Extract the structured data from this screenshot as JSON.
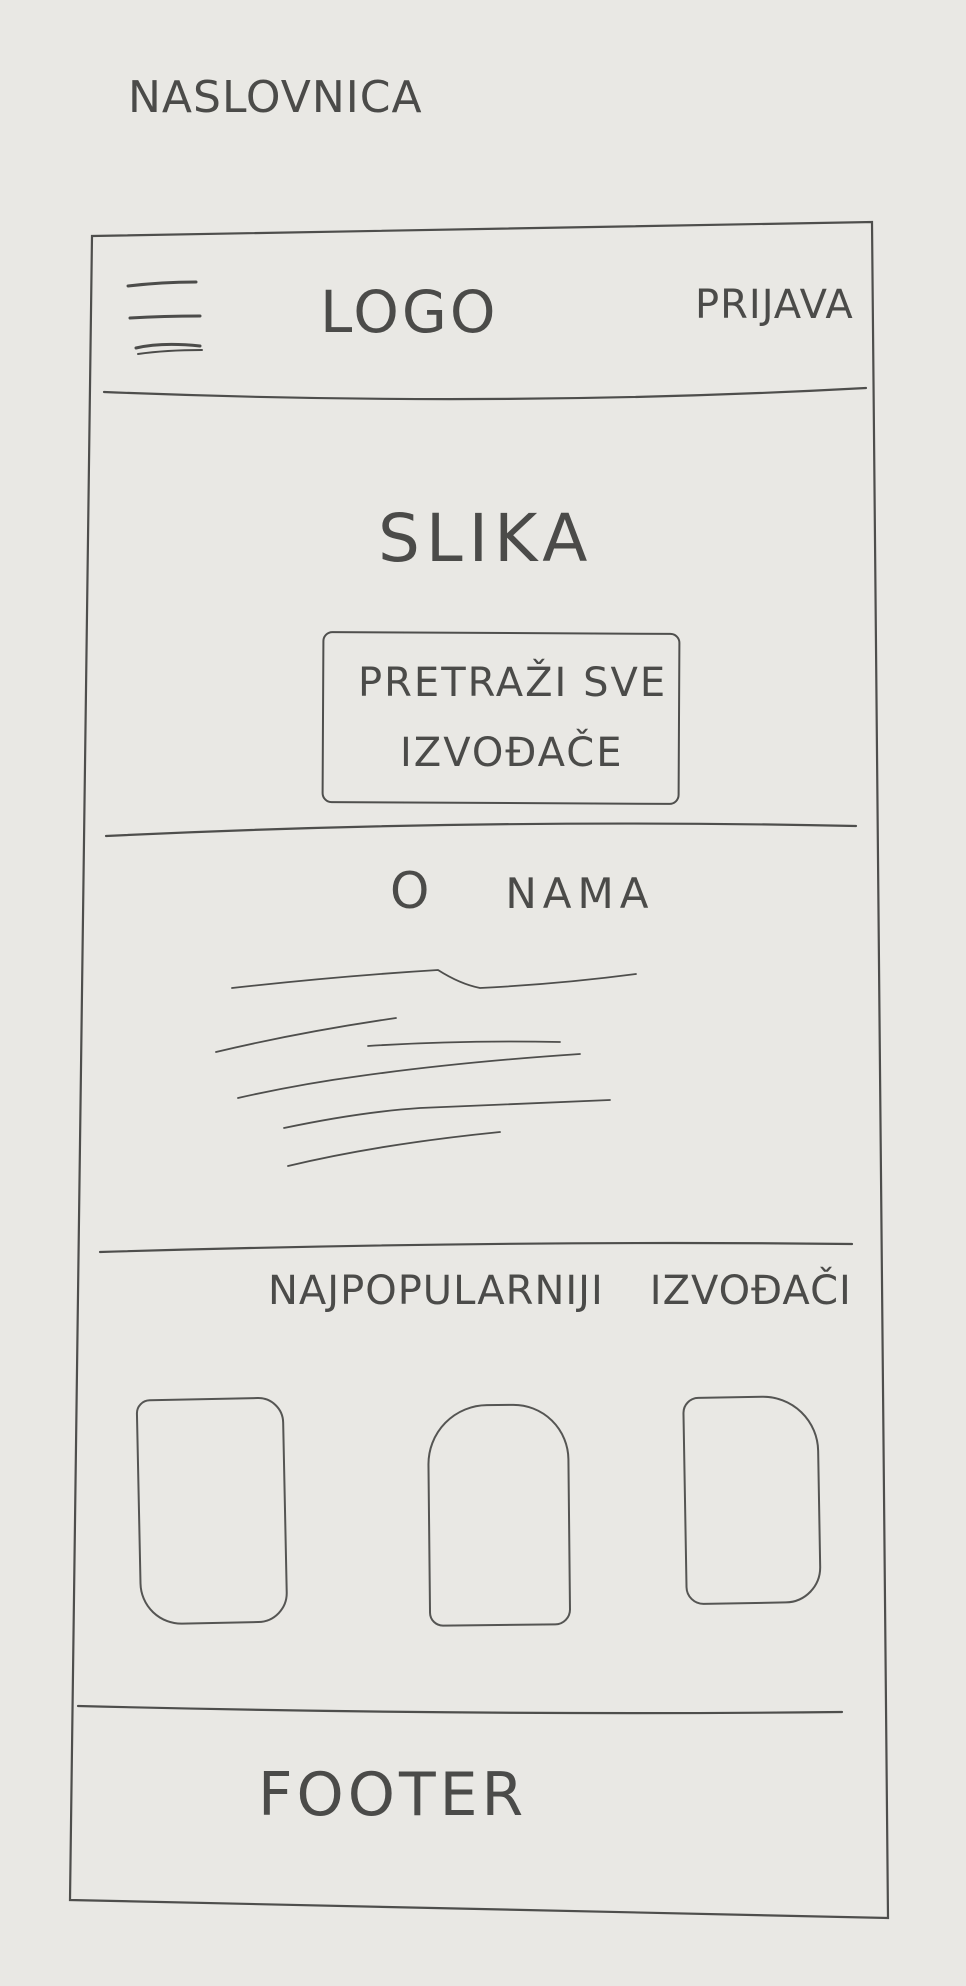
{
  "page_title": "NASLOVNICA",
  "header": {
    "menu_icon": "hamburger-menu-icon",
    "logo": "LOGO",
    "login": "PRIJAVA"
  },
  "hero": {
    "image_label": "SLIKA",
    "search_line_1": "PRETRAŽI SVE",
    "search_line_2": "IZVOĐAČE"
  },
  "about": {
    "title_letter": "O",
    "title_word": "NAMA"
  },
  "popular": {
    "title_word_1": "NAJPOPULARNIJI",
    "title_word_2": "IZVOĐAČI",
    "cards": 3
  },
  "footer": {
    "label": "FOOTER"
  }
}
